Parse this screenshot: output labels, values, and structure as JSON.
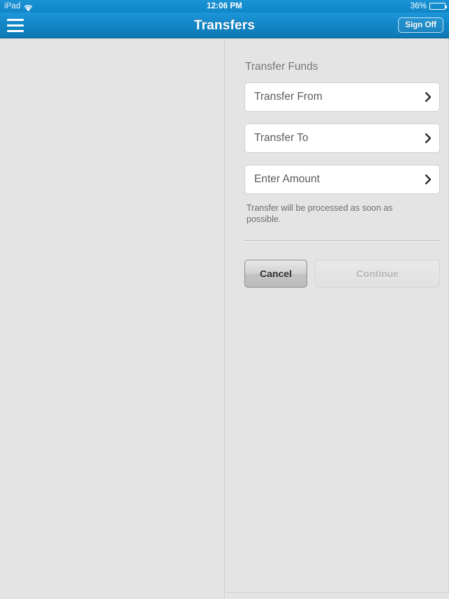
{
  "status_bar": {
    "device_label": "iPad",
    "wifi_icon": "wifi-icon",
    "time": "12:06 PM",
    "battery_percent_label": "36%",
    "battery_level": 36
  },
  "nav_bar": {
    "menu_icon": "hamburger-menu-icon",
    "title": "Transfers",
    "sign_off_label": "Sign Off"
  },
  "transfer_form": {
    "section_title": "Transfer Funds",
    "rows": [
      {
        "label": "Transfer From",
        "chevron_icon": "chevron-right-icon"
      },
      {
        "label": "Transfer To",
        "chevron_icon": "chevron-right-icon"
      },
      {
        "label": "Enter Amount",
        "chevron_icon": "chevron-right-icon"
      }
    ],
    "helper_text": "Transfer will be processed as soon as possible.",
    "cancel_label": "Cancel",
    "continue_label": "Continue"
  },
  "colors": {
    "header_blue": "#1184c4",
    "page_background": "#e4e4e4",
    "field_background": "#ffffff",
    "text_muted": "#6d6e71",
    "disabled_text": "#b5b5b5"
  }
}
